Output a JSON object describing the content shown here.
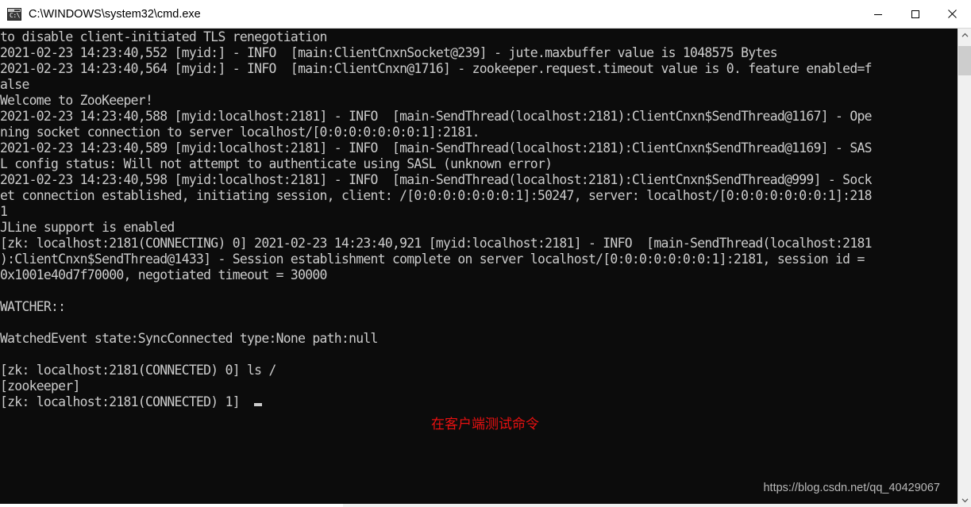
{
  "window": {
    "title": "C:\\WINDOWS\\system32\\cmd.exe",
    "icon_glyph": "C:\\",
    "background_color": "#0c0c0c",
    "titlebar_color": "#ffffff",
    "controls": {
      "minimize_label": "Minimize",
      "maximize_label": "Maximize",
      "close_label": "Close"
    }
  },
  "terminal": {
    "text_color": "#cccccc",
    "lines": [
      "to disable client-initiated TLS renegotiation",
      "2021-02-23 14:23:40,552 [myid:] - INFO  [main:ClientCnxnSocket@239] - jute.maxbuffer value is 1048575 Bytes",
      "2021-02-23 14:23:40,564 [myid:] - INFO  [main:ClientCnxn@1716] - zookeeper.request.timeout value is 0. feature enabled=f",
      "alse",
      "Welcome to ZooKeeper!",
      "2021-02-23 14:23:40,588 [myid:localhost:2181] - INFO  [main-SendThread(localhost:2181):ClientCnxn$SendThread@1167] - Ope",
      "ning socket connection to server localhost/[0:0:0:0:0:0:0:1]:2181.",
      "2021-02-23 14:23:40,589 [myid:localhost:2181] - INFO  [main-SendThread(localhost:2181):ClientCnxn$SendThread@1169] - SAS",
      "L config status: Will not attempt to authenticate using SASL (unknown error)",
      "2021-02-23 14:23:40,598 [myid:localhost:2181] - INFO  [main-SendThread(localhost:2181):ClientCnxn$SendThread@999] - Sock",
      "et connection established, initiating session, client: /[0:0:0:0:0:0:0:1]:50247, server: localhost/[0:0:0:0:0:0:0:1]:218",
      "1",
      "JLine support is enabled",
      "[zk: localhost:2181(CONNECTING) 0] 2021-02-23 14:23:40,921 [myid:localhost:2181] - INFO  [main-SendThread(localhost:2181",
      "):ClientCnxn$SendThread@1433] - Session establishment complete on server localhost/[0:0:0:0:0:0:0:1]:2181, session id = ",
      "0x1001e40d7f70000, negotiated timeout = 30000",
      "",
      "WATCHER::",
      "",
      "WatchedEvent state:SyncConnected type:None path:null",
      "",
      "[zk: localhost:2181(CONNECTED) 0] ls /",
      "[zookeeper]",
      "[zk: localhost:2181(CONNECTED) 1] "
    ]
  },
  "annotation": {
    "text": "在客户端测试命令",
    "color": "#e81010"
  },
  "watermark": {
    "text": "https://blog.csdn.net/qq_40429067"
  },
  "scrollbar": {
    "up_arrow": "▲",
    "down_arrow": "▼"
  }
}
